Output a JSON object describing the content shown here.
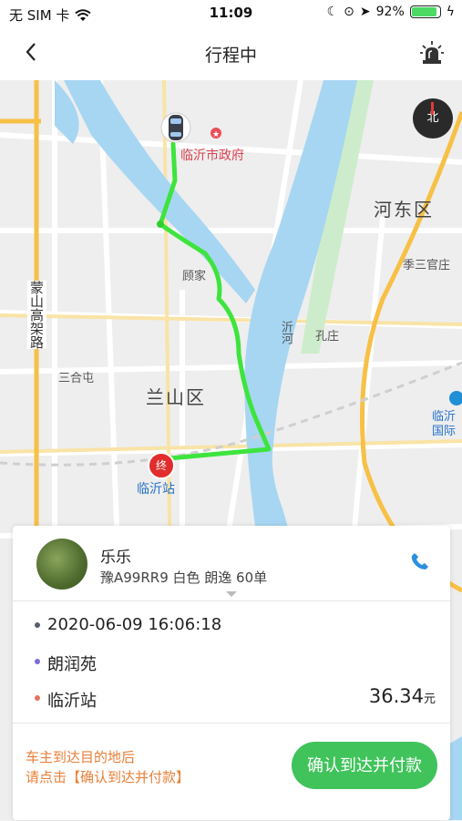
{
  "status_bar": {
    "carrier": "无 SIM 卡",
    "time": "11:09",
    "battery": "92%"
  },
  "nav": {
    "title": "行程中"
  },
  "map": {
    "labels": {
      "gov": "临沂市政府",
      "hedong": "河东区",
      "jisan": "季三官庄",
      "gujia": "顾家",
      "yihe": "沂河",
      "kongzhuang": "孔庄",
      "sanhetun": "三合屯",
      "lanshan": "兰山区",
      "linyi_station": "临沂站",
      "airport": "临沂\n国际",
      "mengshan": "蒙山高架路",
      "end_marker": "终"
    },
    "colors": {
      "route": "#3ee43e",
      "river": "#a7d6f2",
      "highway": "#f7c046"
    }
  },
  "driver": {
    "name": "乐乐",
    "info": "豫A99RR9 白色 朗逸 60单"
  },
  "trip": {
    "time": "2020-06-09 16:06:18",
    "origin": "朗润苑",
    "destination": "临沂站",
    "price": "36.34",
    "price_unit": "元"
  },
  "footer": {
    "hint_line1": "车主到达目的地后",
    "hint_line2": "请点击【确认到达并付款】",
    "pay_button": "确认到达并付款"
  }
}
